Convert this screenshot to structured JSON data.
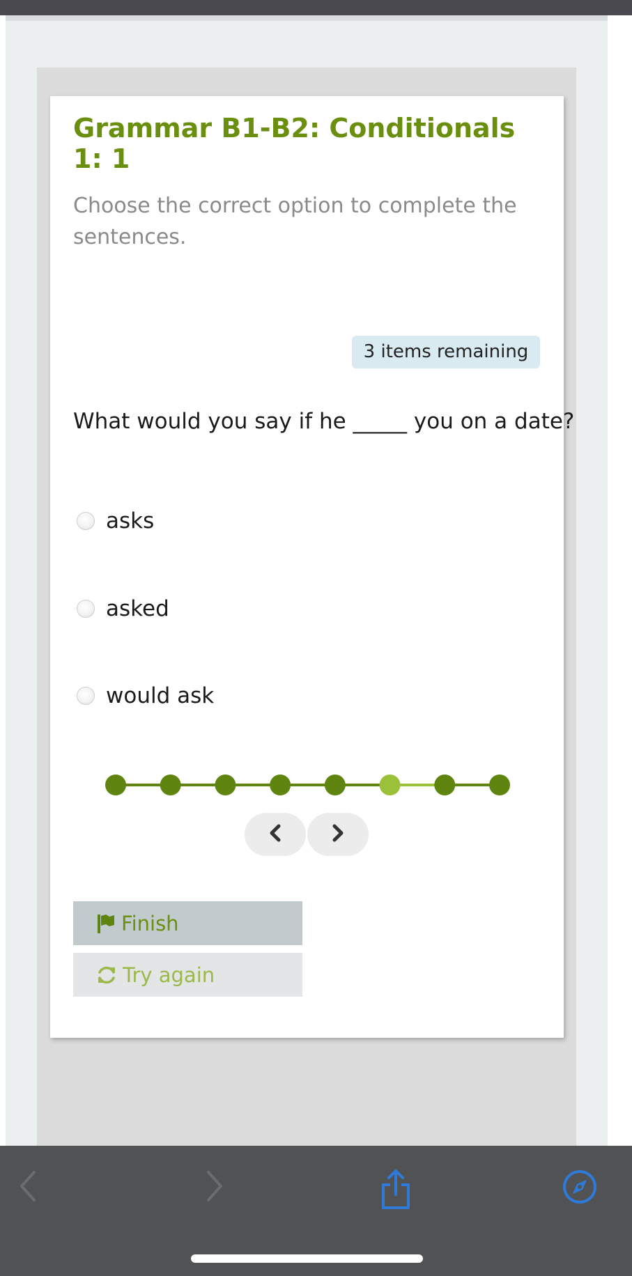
{
  "quiz": {
    "title": "Grammar B1-B2: Conditionals 1: 1",
    "instructions": "Choose the correct option to complete the sentences.",
    "remaining_label": "3 items remaining",
    "question": "What would you say if he _____ you on a date?",
    "options": [
      {
        "label": "asks",
        "selected": false
      },
      {
        "label": "asked",
        "selected": false
      },
      {
        "label": "would ask",
        "selected": false
      }
    ],
    "progress": {
      "total_steps": 8,
      "current_step": 6,
      "color_done": "#5f8410",
      "color_current": "#9bc13b"
    },
    "nav": {
      "prev_icon": "chevron-left-icon",
      "next_icon": "chevron-right-icon"
    },
    "finish_label": "Finish",
    "finish_icon": "flag-icon",
    "try_again_label": "Try again",
    "try_again_icon": "refresh-icon"
  },
  "browser_toolbar": {
    "back_icon": "chevron-left-icon",
    "forward_icon": "chevron-right-icon",
    "share_icon": "share-icon",
    "safari_icon": "compass-icon",
    "accent": "#2f7ad8"
  },
  "colors": {
    "title_green": "#6a8f0e",
    "badge_bg": "#d9ebf1"
  }
}
